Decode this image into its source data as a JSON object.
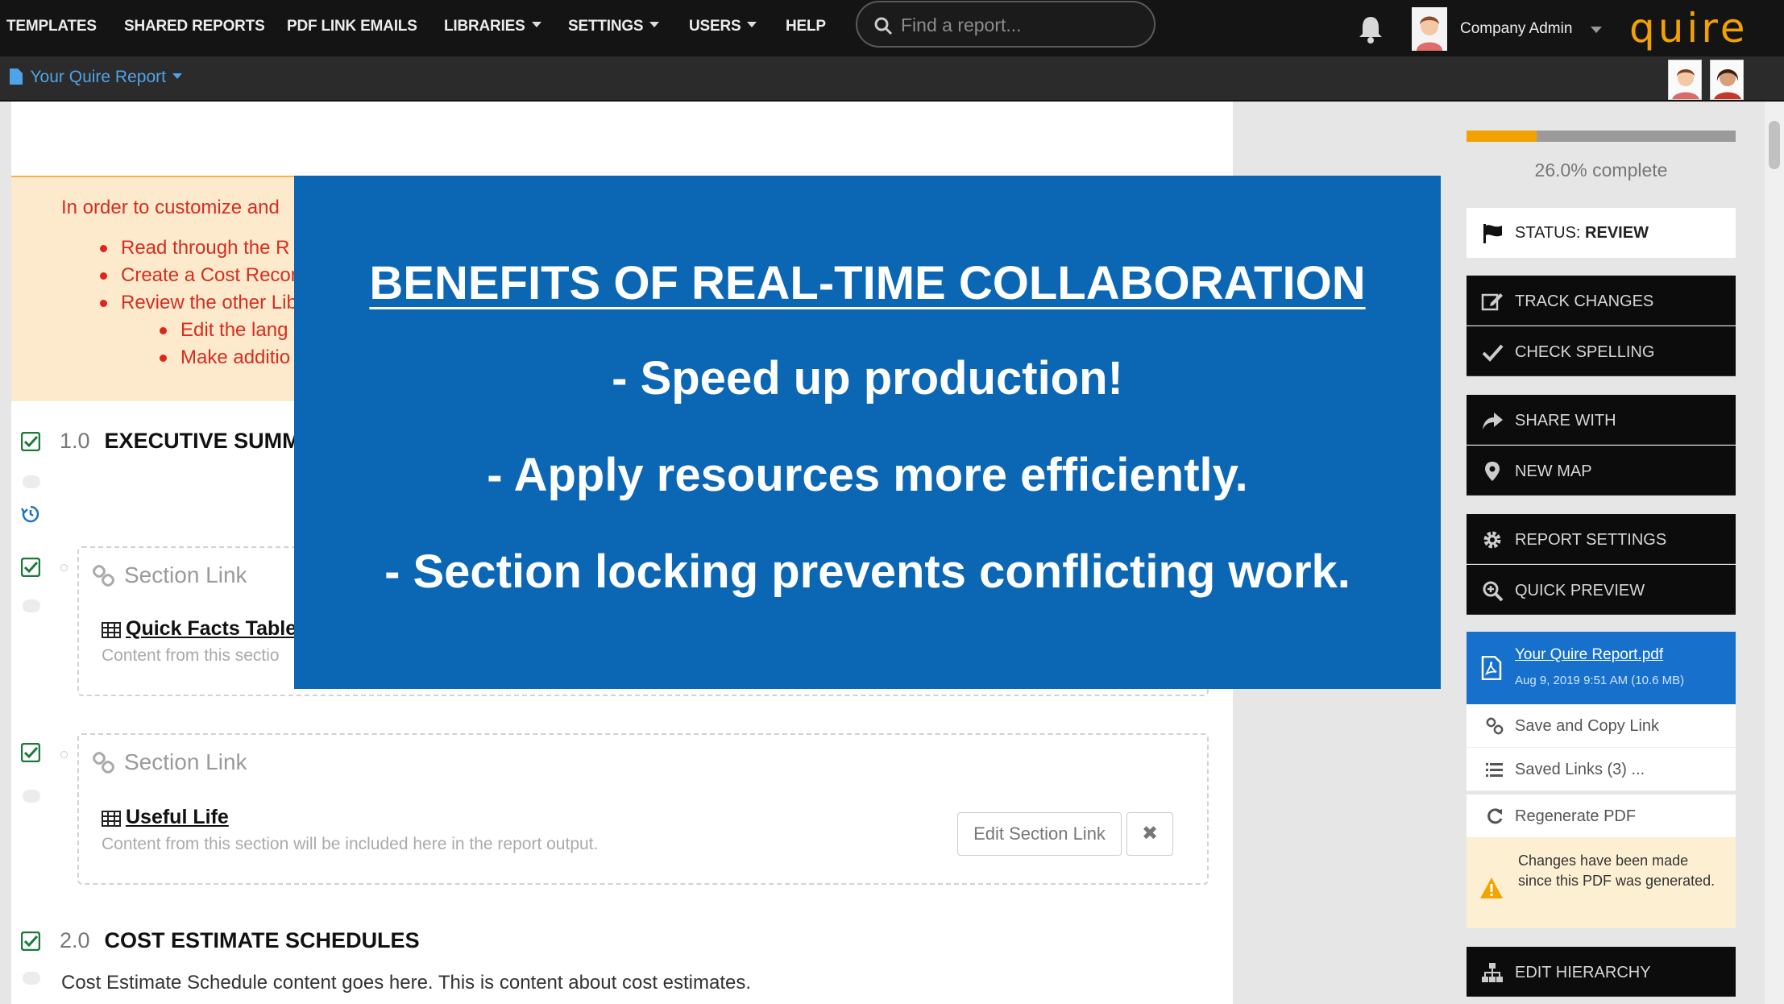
{
  "nav": {
    "templates": "TEMPLATES",
    "shared_reports": "SHARED REPORTS",
    "pdf_link_emails": "PDF LINK EMAILS",
    "libraries": "LIBRARIES",
    "settings": "SETTINGS",
    "users": "USERS",
    "help": "HELP"
  },
  "search": {
    "placeholder": "Find a report..."
  },
  "user": {
    "name": "Company Admin"
  },
  "brand": {
    "logo_text": "quire",
    "accent_color": "#f2a100"
  },
  "subbar": {
    "report_name": "Your Quire Report"
  },
  "notice": {
    "intro": "In order to customize and",
    "items": [
      "Read through the R",
      "Create a Cost Recon",
      "Review the other Lib"
    ],
    "subitems": [
      "Edit the lang",
      "Make additio"
    ]
  },
  "sections": {
    "exec": {
      "number": "1.0",
      "title": "EXECUTIVE SUMM"
    },
    "link1": {
      "label": "Section Link",
      "name": "Quick Facts Table",
      "desc": "Content from this sectio"
    },
    "link2": {
      "label": "Section Link",
      "name": "Useful Life",
      "desc": "Content from this section will be included here in the report output.",
      "edit_label": "Edit Section Link",
      "remove_label": "✖"
    },
    "cost": {
      "number": "2.0",
      "title": "COST ESTIMATE SCHEDULES",
      "body": "Cost Estimate Schedule content goes here. This is content about cost estimates."
    }
  },
  "sidebar": {
    "progress_percent": 26.0,
    "progress_label": "26.0% complete",
    "status_prefix": "STATUS:",
    "status_value": "REVIEW",
    "buttons": {
      "track_changes": "TRACK CHANGES",
      "check_spelling": "CHECK SPELLING",
      "share_with": "SHARE WITH",
      "new_map": "NEW MAP",
      "report_settings": "REPORT SETTINGS",
      "quick_preview": "QUICK PREVIEW",
      "edit_hierarchy": "EDIT HIERARCHY"
    },
    "pdf": {
      "name": "Your Quire Report.pdf",
      "meta": "Aug 9, 2019 9:51 AM (10.6 MB)",
      "save_copy": "Save and Copy Link",
      "saved_links": "Saved Links (3) ...",
      "regenerate": "Regenerate PDF",
      "warning": "Changes have been made since this PDF was generated."
    }
  },
  "overlay": {
    "title": "BENEFITS OF REAL-TIME COLLABORATION",
    "line1": "- Speed up production!",
    "line2": "- Apply resources more efficiently.",
    "line3": "- Section locking prevents conflicting work.",
    "bg_color": "#0b66b4"
  }
}
